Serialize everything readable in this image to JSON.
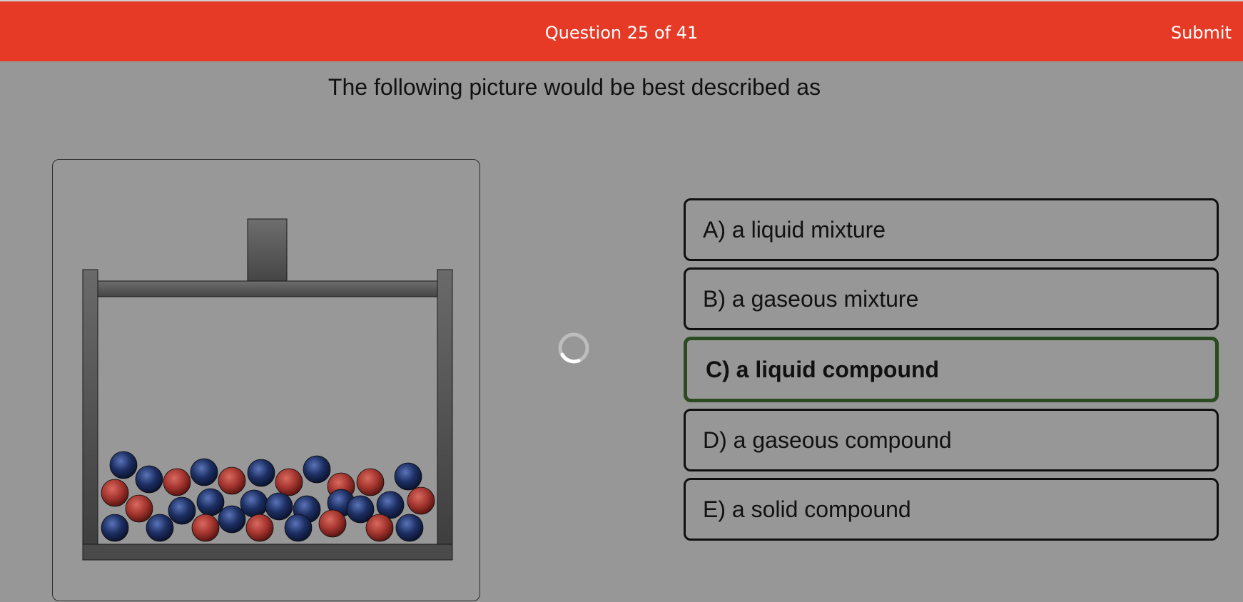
{
  "header": {
    "question_counter": "Question 25 of 41",
    "submit_label": "Submit",
    "background_color": "#e63a27"
  },
  "question": {
    "text": "The following picture would be best described as"
  },
  "options": [
    {
      "label": "A) a liquid mixture",
      "selected": false
    },
    {
      "label": "B) a gaseous mixture",
      "selected": false
    },
    {
      "label": "C) a liquid compound",
      "selected": true
    },
    {
      "label": "D) a gaseous compound",
      "selected": false
    },
    {
      "label": "E) a solid compound",
      "selected": false
    }
  ],
  "colors": {
    "page_background": "#979797",
    "selected_border": "#2a4b1f",
    "particle_red": "#a5362f",
    "particle_blue": "#1d2f63"
  },
  "loading_indicator": "spinner-icon"
}
